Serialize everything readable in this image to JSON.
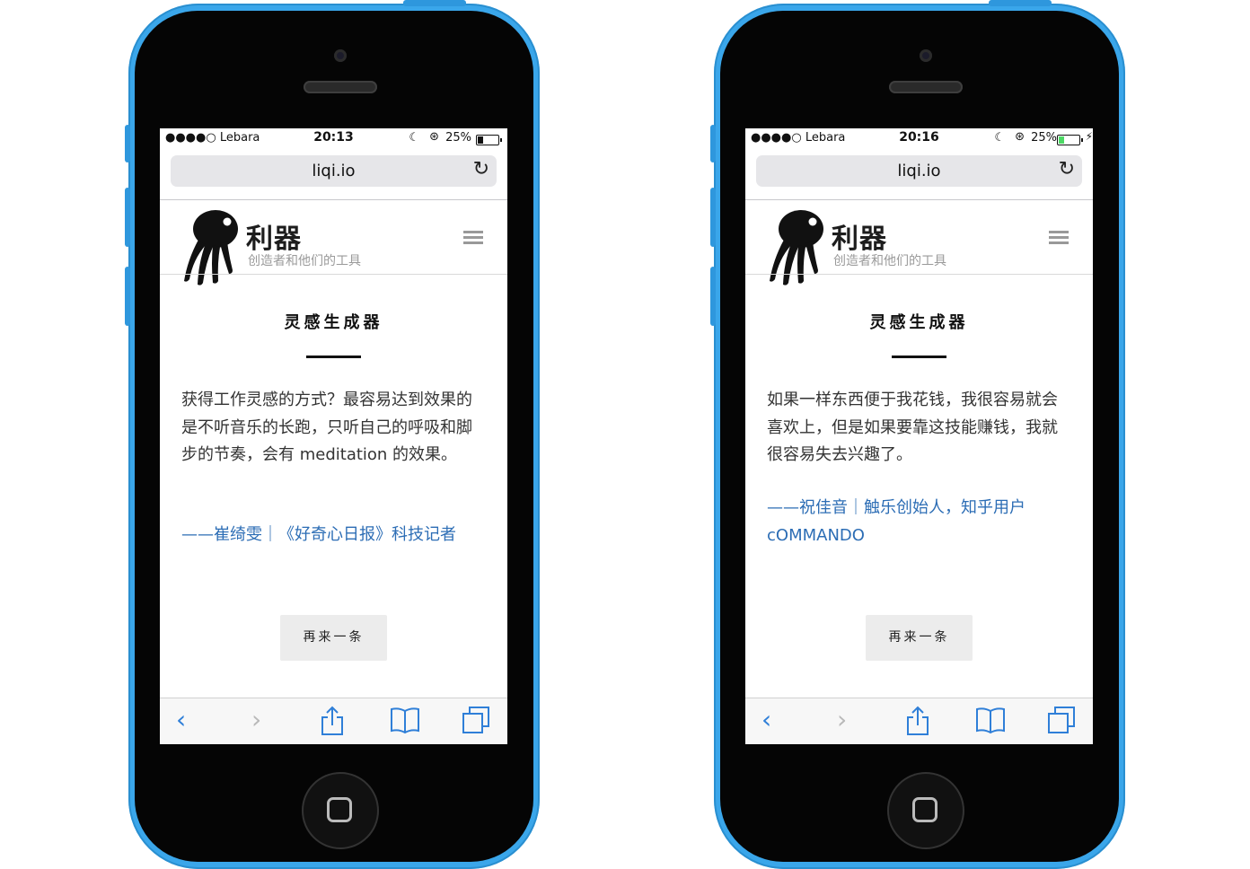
{
  "screens": [
    {
      "status": {
        "carrier": "●●●●○ Lebara",
        "time": "20:13",
        "battery": "25%",
        "battery_fraction": 0.25,
        "charging": false
      },
      "url": "liqi.io",
      "brand": "利器",
      "tagline": "创造者和他们的工具",
      "page_title": "灵感生成器",
      "quote": "获得工作灵感的方式？最容易达到效果的是不听音乐的长跑，只听自己的呼吸和脚步的节奏，会有 meditation 的效果。",
      "attribution": "——崔绮雯｜《好奇心日报》科技记者",
      "again_button": "再来一条"
    },
    {
      "status": {
        "carrier": "●●●●○ Lebara",
        "time": "20:16",
        "battery": "25%",
        "battery_fraction": 0.25,
        "charging": true
      },
      "url": "liqi.io",
      "brand": "利器",
      "tagline": "创造者和他们的工具",
      "page_title": "灵感生成器",
      "quote": "如果一样东西便于我花钱，我很容易就会喜欢上，但是如果要靠这技能赚钱，我就很容易失去兴趣了。",
      "attribution": "——祝佳音｜触乐创始人，知乎用户 cOMMANDO",
      "again_button": "再来一条"
    }
  ],
  "toolbar_icons": [
    "back-icon",
    "forward-icon",
    "share-icon",
    "bookmarks-icon",
    "tabs-icon"
  ],
  "colors": {
    "phone_body": "#3aa6ea",
    "link": "#2c6db5",
    "toolbar_icon": "#2f7fd8"
  }
}
